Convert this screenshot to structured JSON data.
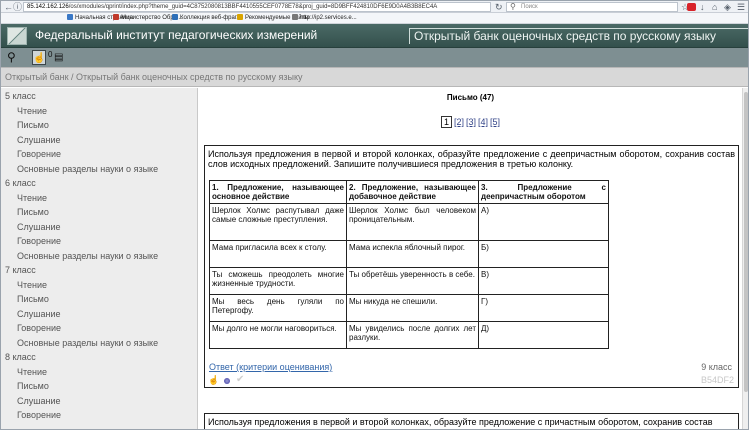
{
  "browser": {
    "url_domain": "85.142.162.126",
    "url_rest": "/os/xmodules/qprint/index.php?theme_guid=4C8752080813BBF4410555CEF0778E78&proj_guid=8D9BFF424810DF6E9D0A4B3B8EC4A",
    "search_placeholder": "Поиск",
    "icons": [
      "back-icon",
      "forward-icon",
      "reload-icon",
      "star-icon",
      "download-icon",
      "home-icon",
      "adblock-icon",
      "menu-icon"
    ]
  },
  "bookmarks": [
    {
      "label": "Начальная страница",
      "color": "#3a78c6"
    },
    {
      "label": "Министерство Обра...",
      "color": "#c0392b"
    },
    {
      "label": "Коллекция веб-фраг...",
      "color": "#2d6fb8"
    },
    {
      "label": "Рекомендуемые сайты",
      "color": "#d9a400"
    },
    {
      "label": "http://ip2.services.e...",
      "color": "#777777"
    }
  ],
  "header": {
    "site_name": "Федеральный институт педагогических измерений",
    "bank_name": "Открытый банк оценочных средств по русскому языку"
  },
  "toolbar": {
    "selected_count": "0"
  },
  "breadcrumb": "Открытый банк / Открытый банк оценочных средств по русскому языку",
  "sidebar": {
    "groups": [
      {
        "grade": "5 класс",
        "items": [
          "Чтение",
          "Письмо",
          "Слушание",
          "Говорение",
          "Основные разделы науки о языке"
        ]
      },
      {
        "grade": "6 класс",
        "items": [
          "Чтение",
          "Письмо",
          "Слушание",
          "Говорение",
          "Основные разделы науки о языке"
        ]
      },
      {
        "grade": "7 класс",
        "items": [
          "Чтение",
          "Письмо",
          "Слушание",
          "Говорение",
          "Основные разделы науки о языке"
        ]
      },
      {
        "grade": "8 класс",
        "items": [
          "Чтение",
          "Письмо",
          "Слушание",
          "Говорение"
        ]
      }
    ]
  },
  "main": {
    "title": "Письмо (47)",
    "pages": [
      "1",
      "[2]",
      "[3]",
      "[4]",
      "[5]"
    ],
    "task1": {
      "text": "Используя предложения в первой и второй колонках, образуйте предложение с деепричастным оборотом, сохранив состав слов исходных предложений. Запишите получившиеся предложения в третью колонку.",
      "headers": [
        "1. Предложение, называющее основное действие",
        "2. Предложение, называющее добавочное действие",
        "3. Предложение с деепричастным оборотом"
      ],
      "rows": [
        [
          "Шерлок Холмс распутывал даже самые сложные преступления.",
          "Шерлок Холмс был человеком проницательным.",
          "А)"
        ],
        [
          "Мама пригласила всех к столу.",
          "Мама испекла яблочный пирог.",
          "Б)"
        ],
        [
          "Ты сможешь преодолеть многие жизненные трудности.",
          "Ты обретёшь уверенность в себе.",
          "В)"
        ],
        [
          "Мы весь день гуляли по Петергофу.",
          "Мы никуда не спешили.",
          "Г)"
        ],
        [
          "Мы долго не могли наговориться.",
          "Мы увиделись после долгих лет разлуки.",
          "Д)"
        ]
      ],
      "answer_link": "Ответ (критерии оценивания)",
      "grade": "9 класс",
      "code": "B54DF2"
    },
    "task2": {
      "text": "Используя предложения в первой и второй колонках, образуйте предложение с причастным оборотом, сохранив состав"
    }
  }
}
